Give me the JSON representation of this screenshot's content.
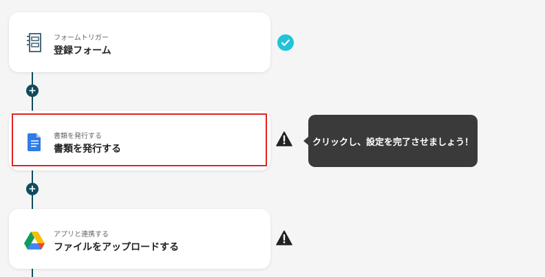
{
  "steps": [
    {
      "subtitle": "フォームトリガー",
      "title": "登録フォーム",
      "icon": "form-trigger-icon",
      "status": "check-icon"
    },
    {
      "subtitle": "書類を発行する",
      "title": "書類を発行する",
      "icon": "google-docs-icon",
      "status": "warning-icon",
      "highlighted": true
    },
    {
      "subtitle": "アプリと連携する",
      "title": "ファイルをアップロードする",
      "icon": "google-drive-icon",
      "status": "warning-icon"
    }
  ],
  "tooltip": {
    "text": "クリックし、設定を完了させましょう！"
  },
  "add_button": {
    "glyph": "+"
  },
  "colors": {
    "connector": "#0f4c5c",
    "check": "#22c3d9",
    "warning": "#222222",
    "highlight": "#e02020",
    "tooltip_bg": "#3a3a3a"
  }
}
